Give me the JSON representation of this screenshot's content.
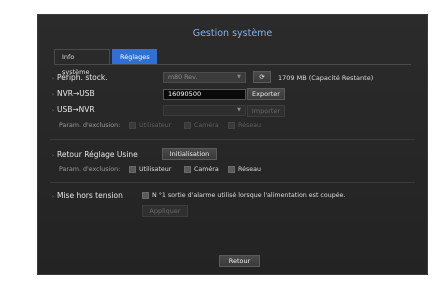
{
  "dialog": {
    "title": "Gestion système"
  },
  "tabs": [
    {
      "label": "Info système"
    },
    {
      "label": "Réglages"
    }
  ],
  "storage": {
    "label": "Périph. stock.",
    "device_value": "m80 Rev.",
    "capacity_text": "1709 MB  (Capacité Restante)"
  },
  "nvr_usb": {
    "label": "NVR→USB",
    "filename": "16090500",
    "export_label": "Exporter"
  },
  "usb_nvr": {
    "label": "USB→NVR",
    "file_value": "",
    "import_label": "Importer"
  },
  "exclusion1": {
    "label": "Param. d'exclusion:",
    "options": [
      "Utilisateur",
      "Caméra",
      "Réseau"
    ]
  },
  "factory": {
    "label": "Retour Réglage Usine",
    "init_label": "Initialisation"
  },
  "exclusion2": {
    "label": "Param. d'exclusion:",
    "options": [
      "Utilisateur",
      "Caméra",
      "Réseau"
    ]
  },
  "shutdown": {
    "label": "Mise hors tension",
    "option_text": "N °1 sortie d'alarme utilisé lorsque l'alimentation est coupée.",
    "apply_label": "Appliquer"
  },
  "footer": {
    "back_label": "Retour"
  }
}
